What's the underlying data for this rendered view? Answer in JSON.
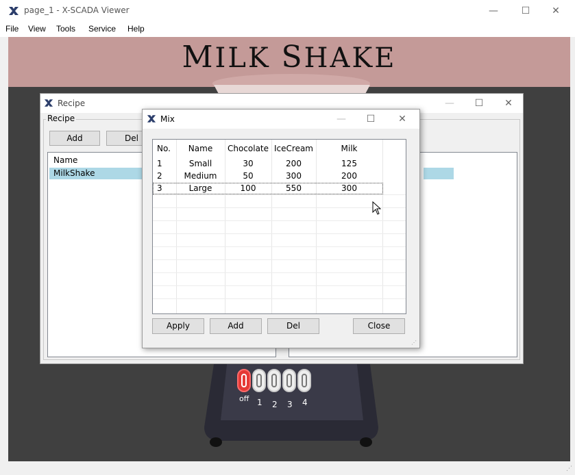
{
  "window": {
    "title": "page_1 - X-SCADA Viewer",
    "minimize": "—",
    "maximize": "☐",
    "close": "✕"
  },
  "menu": [
    "File",
    "View",
    "Tools",
    "Service",
    "Help"
  ],
  "banner": {
    "title_first": "M",
    "title_rest1": "ILK ",
    "title_second": "S",
    "title_rest2": "HAKE"
  },
  "recipe_dialog": {
    "title": "Recipe",
    "group_label": "Recipe",
    "add_label": "Add",
    "del_label": "Del",
    "list_header": "Name",
    "items": [
      "MilkShake"
    ]
  },
  "mix_dialog": {
    "title": "Mix",
    "columns": [
      "No.",
      "Name",
      "Chocolate",
      "IceCream",
      "Milk"
    ],
    "rows": [
      [
        "1",
        "Small",
        "30",
        "200",
        "125"
      ],
      [
        "2",
        "Medium",
        "50",
        "300",
        "200"
      ],
      [
        "3",
        "Large",
        "100",
        "550",
        "300"
      ]
    ],
    "buttons": {
      "apply": "Apply",
      "add": "Add",
      "del": "Del",
      "close": "Close"
    }
  },
  "knobs": {
    "labels": [
      "off",
      "1",
      "2",
      "3",
      "4"
    ],
    "active_color": "#e53935"
  },
  "colors": {
    "banner": "#c49a98",
    "canvas": "#404040",
    "selection": "#add8e6"
  }
}
